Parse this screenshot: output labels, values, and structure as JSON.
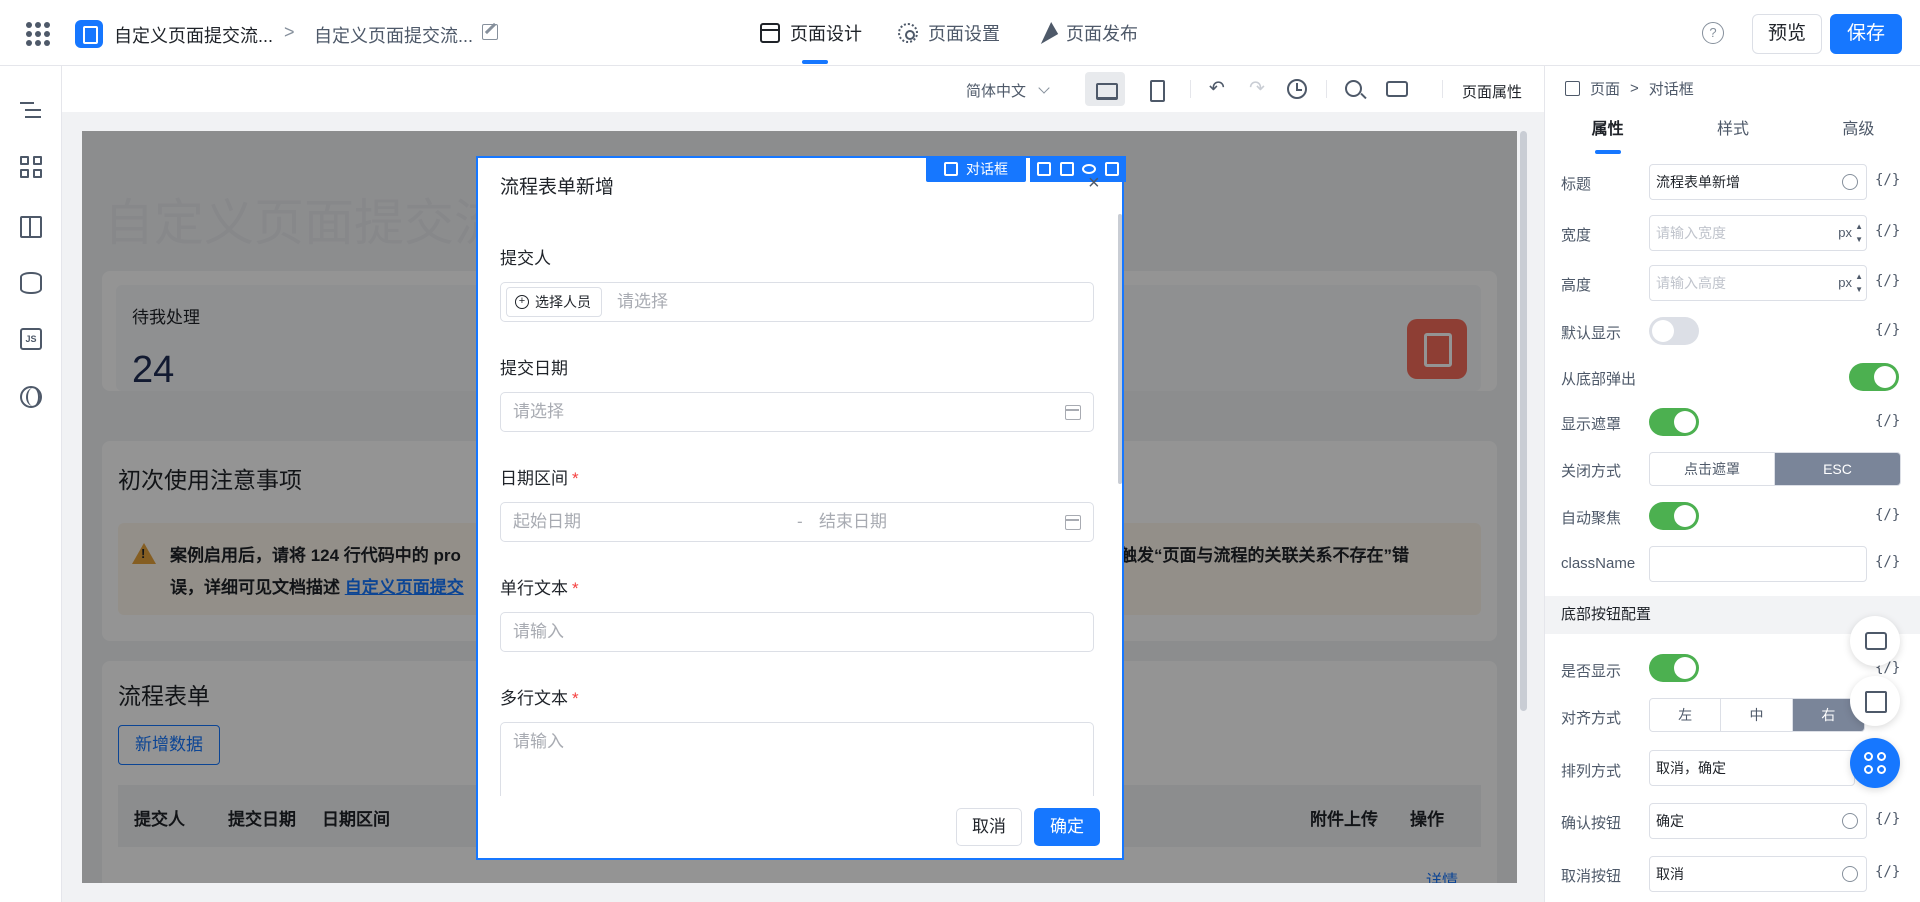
{
  "header": {
    "app_name": "自定义页面提交流...",
    "breadcrumb_sep": ">",
    "page_name": "自定义页面提交流...",
    "tabs": [
      {
        "label": "页面设计",
        "icon": "window-icon",
        "active": true
      },
      {
        "label": "页面设置",
        "icon": "gear-icon",
        "active": false
      },
      {
        "label": "页面发布",
        "icon": "send-icon",
        "active": false
      }
    ],
    "help": "?",
    "preview_label": "预览",
    "save_label": "保存",
    "accent": "#1677ff"
  },
  "left_rail": [
    "outline-tree-icon",
    "components-grid-icon",
    "layout-icon",
    "data-source-icon",
    "js-code-icon",
    "globe-icon"
  ],
  "toolbar": {
    "language": "简体中文",
    "undo": "↶",
    "redo": "↷",
    "page_attr_label": "页面属性"
  },
  "canvas": {
    "bg_title": "自定义页面提交流程",
    "todo": {
      "label": "待我处理",
      "count": "24"
    },
    "notice": {
      "title": "初次使用注意事项",
      "line1_a": "案例启用后，请将 124 行代码中的 pro",
      "line1_b": "触发“页面与流程的关联关系不存在”错",
      "line2_prefix": "误，详细可见文档描述 ",
      "line2_link": "自定义页面提交"
    },
    "flow": {
      "title": "流程表单",
      "add_button": "新增数据",
      "columns": [
        "提交人",
        "提交日期",
        "日期区间",
        "附件上传",
        "操作"
      ],
      "row_action": "详情"
    }
  },
  "dialog": {
    "title": "流程表单新增",
    "tag_label": "对话框",
    "close": "×",
    "fields": {
      "submitter": {
        "label": "提交人",
        "button": "选择人员",
        "placeholder": "请选择"
      },
      "submit_date": {
        "label": "提交日期",
        "placeholder": "请选择"
      },
      "date_range": {
        "label": "日期区间",
        "required": "*",
        "start_placeholder": "起始日期",
        "sep": "-",
        "end_placeholder": "结束日期"
      },
      "single_text": {
        "label": "单行文本",
        "required": "*",
        "placeholder": "请输入"
      },
      "multi_text": {
        "label": "多行文本",
        "required": "*",
        "placeholder": "请输入"
      }
    },
    "cancel_label": "取消",
    "ok_label": "确定"
  },
  "right_panel": {
    "breadcrumb": {
      "root": "页面",
      "sep": ">",
      "current": "对话框"
    },
    "tabs": [
      {
        "label": "属性",
        "active": true
      },
      {
        "label": "样式",
        "active": false
      },
      {
        "label": "高级",
        "active": false
      }
    ],
    "props": {
      "title_label": "标题",
      "title_value": "流程表单新增",
      "width_label": "宽度",
      "width_placeholder": "请输入宽度",
      "unit": "px",
      "height_label": "高度",
      "height_placeholder": "请输入高度",
      "default_show_label": "默认显示",
      "default_show": false,
      "bottom_popup_label": "从底部弹出",
      "bottom_popup": true,
      "mask_label": "显示遮罩",
      "mask": true,
      "close_mode_label": "关闭方式",
      "close_mode_options": [
        "点击遮罩",
        "ESC"
      ],
      "close_mode_selected": "ESC",
      "autofocus_label": "自动聚焦",
      "autofocus": true,
      "classname_label": "className",
      "classname_value": ""
    },
    "footer_section": "底部按钮配置",
    "footer": {
      "show_label": "是否显示",
      "show": true,
      "align_label": "对齐方式",
      "align_options": [
        "左",
        "中",
        "右"
      ],
      "align_selected": "右",
      "order_label": "排列方式",
      "order_value": "取消，确定",
      "confirm_label": "确认按钮",
      "confirm_value": "确定",
      "cancel_label": "取消按钮",
      "cancel_value": "取消"
    },
    "expr_label": "{/}"
  }
}
